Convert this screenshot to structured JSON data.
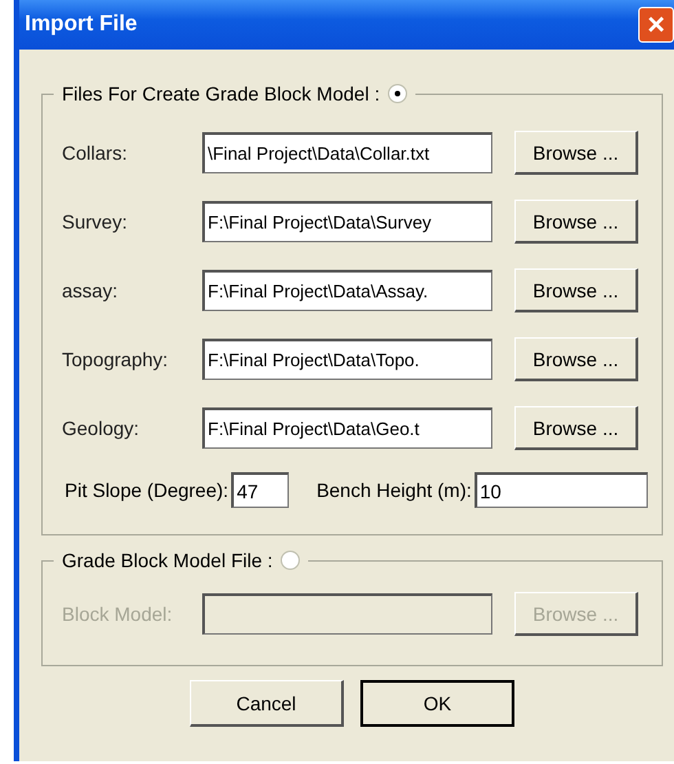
{
  "window": {
    "title": "Import File",
    "close": "×"
  },
  "groups": [
    {
      "label": "Files For Create Grade Block Model :",
      "selected": true,
      "rows": [
        {
          "label": "Collars:",
          "value": "\\Final Project\\Data\\Collar.txt",
          "button": "Browse ...",
          "disabled": false
        },
        {
          "label": "Survey:",
          "value": "F:\\Final Project\\Data\\Survey",
          "button": "Browse ...",
          "disabled": false
        },
        {
          "label": "assay:",
          "value": "F:\\Final Project\\Data\\Assay.",
          "button": "Browse ...",
          "disabled": false
        },
        {
          "label": "Topography:",
          "value": "F:\\Final Project\\Data\\Topo.",
          "button": "Browse ...",
          "disabled": false
        },
        {
          "label": "Geology:",
          "value": "F:\\Final Project\\Data\\Geo.t",
          "button": "Browse ...",
          "disabled": false
        }
      ],
      "params": [
        {
          "label": "Pit Slope (Degree):",
          "value": "47"
        },
        {
          "label": "Bench Height (m):",
          "value": "10"
        }
      ]
    },
    {
      "label": "Grade Block Model File :",
      "selected": false,
      "rows": [
        {
          "label": "Block Model:",
          "value": "",
          "button": "Browse ...",
          "disabled": true
        }
      ]
    }
  ],
  "buttons": [
    {
      "label": "Cancel",
      "default": false
    },
    {
      "label": "OK",
      "default": true
    }
  ]
}
